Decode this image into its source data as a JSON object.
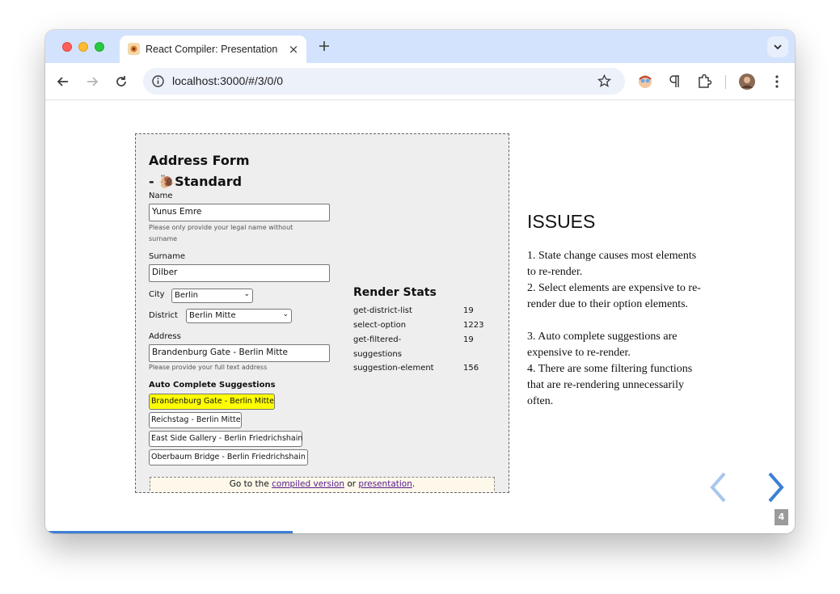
{
  "browser": {
    "tab_title": "React Compiler: Presentation",
    "tab_close": "×",
    "url": "localhost:3000/#/3/0/0"
  },
  "form": {
    "title_line1": "Address Form",
    "title_line2": "- 🐌Standard",
    "name_label": "Name",
    "name_value": "Yunus Emre",
    "name_hint": "Please only provide your legal name without surname",
    "surname_label": "Surname",
    "surname_value": "Dilber",
    "city_label": "City",
    "city_value": "Berlin",
    "district_label": "District",
    "district_value": "Berlin Mitte",
    "address_label": "Address",
    "address_value": "Brandenburg Gate - Berlin Mitte",
    "address_hint": "Please provide your full text address",
    "suggestions_title": "Auto Complete Suggestions",
    "suggestions": [
      "Brandenburg Gate - Berlin Mitte",
      "Reichstag - Berlin Mitte",
      "East Side Gallery - Berlin Friedrichshain",
      "Oberbaum Bridge - Berlin Friedrichshain"
    ]
  },
  "render_stats": {
    "title": "Render Stats",
    "rows": [
      {
        "name": "get-district-list",
        "value": "19"
      },
      {
        "name": "select-option",
        "value": "1223"
      },
      {
        "name": "get-filtered-suggestions",
        "value": "19"
      },
      {
        "name": "suggestion-element",
        "value": "156"
      }
    ]
  },
  "footer": {
    "prefix": "Go to the ",
    "link1": "compiled version",
    "middle": " or ",
    "link2": "presentation",
    "suffix": "."
  },
  "issues": {
    "title": "ISSUES",
    "items": [
      "1. State change causes most elements to re-render.",
      "2. Select elements are expensive to re-render due to their option elements.",
      "3. Auto complete suggestions are expensive to re-render.",
      "4. There are some filtering functions that are re-rendering unnecessarily often."
    ]
  },
  "slide": {
    "page_number": "4",
    "progress_fraction": 0.33
  },
  "colors": {
    "accent": "#3d7fd6",
    "highlight": "#ffff00",
    "tabbar": "#d3e3fd"
  }
}
